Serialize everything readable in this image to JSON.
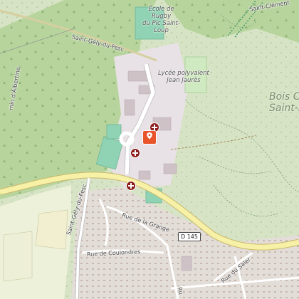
{
  "map": {
    "labels": {
      "school_rugby": [
        "École de",
        "Rugby",
        "du Pic Saint-",
        "Loup"
      ],
      "lycee": [
        "Lycée polyvalent",
        "Jean Jaurès"
      ],
      "bois": [
        "Bois C",
        "Saint-Sau"
      ],
      "saint_gely_road_top": "Saint-Gély-du-Fesc",
      "saint_gely_road_left": "Saint-Gély-du-Fesc",
      "chemin_albertine": "min d'Albertine",
      "saint_clement": "Saint-Clément",
      "rue_grange": "Rue de la Grange",
      "rue_coulondres": "Rue de Coulondres",
      "rue_saler": "Rue du Saler",
      "rue_bottom": "Ru",
      "road_shield": "D 145"
    },
    "markers": [
      {
        "type": "hospital",
        "name": "hospital-marker-1"
      },
      {
        "type": "hospital",
        "name": "hospital-marker-2"
      },
      {
        "type": "hospital",
        "name": "hospital-marker-3"
      },
      {
        "type": "location-pin",
        "name": "selected-location-pin"
      }
    ],
    "colors": {
      "forest": "#b9d3a0",
      "land": "#e5ecd9",
      "road_major": "#f7f1a8",
      "residential": "#e0dcd8",
      "pin": "#e8552a",
      "hospital": "#8b1a1a"
    }
  }
}
